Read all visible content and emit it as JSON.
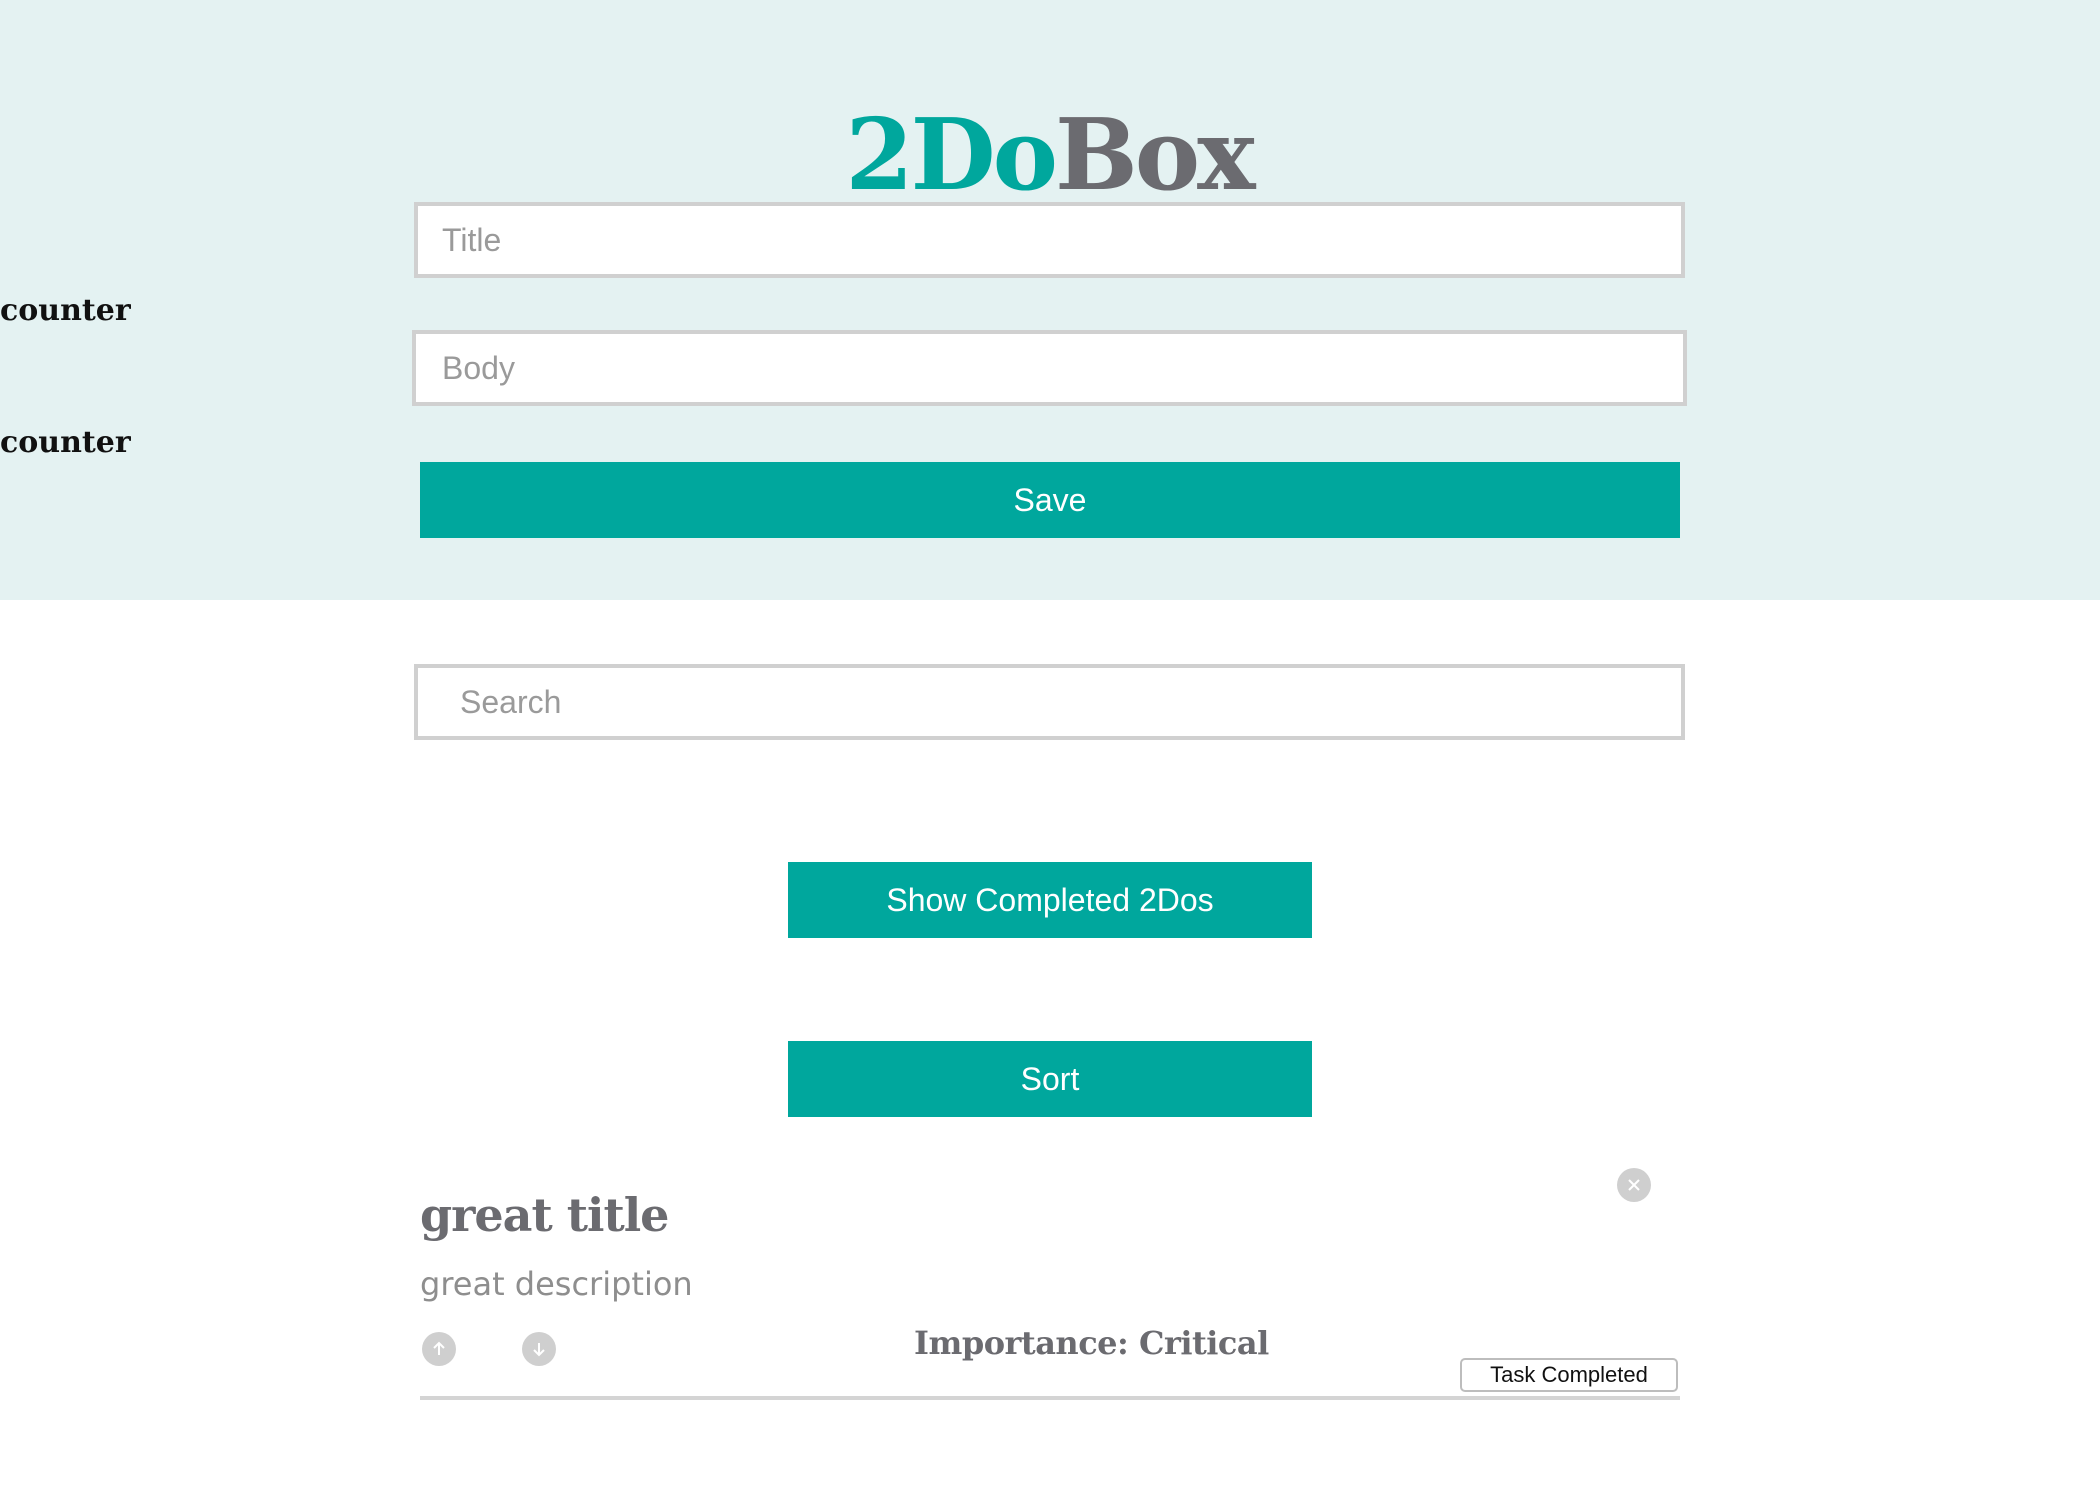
{
  "header": {
    "logo_part1": "2Do",
    "logo_part2": "Box",
    "logo_color_teal": "#00a79d",
    "logo_color_grey": "#6b6b70",
    "background_color": "#e4f2f2"
  },
  "form": {
    "title_placeholder": "Title",
    "title_value": "",
    "title_counter_label": "counter",
    "body_placeholder": "Body",
    "body_value": "",
    "body_counter_label": "counter",
    "save_label": "Save"
  },
  "search": {
    "placeholder": "Search",
    "value": ""
  },
  "controls": {
    "show_completed_label": "Show Completed 2Dos",
    "sort_label": "Sort",
    "accent_color": "#00a79d"
  },
  "todos": [
    {
      "title": "great title",
      "body": "great description",
      "importance_label": "Importance: Critical",
      "completed_button_label": "Task Completed",
      "icons": {
        "delete": "close-icon",
        "upvote": "arrow-up-icon",
        "downvote": "arrow-down-icon"
      }
    }
  ]
}
